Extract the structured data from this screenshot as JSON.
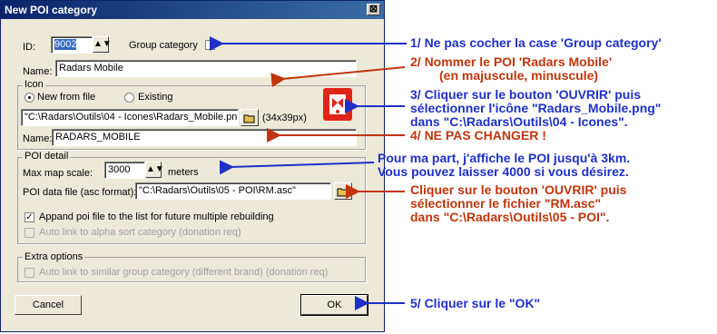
{
  "dialog": {
    "title": "New POI category",
    "close_glyph": "⊠",
    "id_label": "ID:",
    "id_value": "9002",
    "group_category_label": "Group category",
    "group_category_checked": false,
    "name_label": "Name:",
    "name_value": "Radars Mobile",
    "icon": {
      "group_title": "Icon",
      "new_from_file_label": "New from file",
      "existing_label": "Existing",
      "file_path": "\"C:\\Radars\\Outils\\04 - Icones\\Radars_Mobile.pn",
      "size_text": "(34x39px)",
      "name_label": "Name:",
      "name_value": "RADARS_MOBILE"
    },
    "poi_detail": {
      "group_title": "POI detail",
      "max_scale_label": "Max map scale:",
      "max_scale_value": "3000",
      "meters_label": "meters",
      "data_file_label": "POI data file (asc format):",
      "data_file_value": "\"C:\\Radars\\Outils\\05 - POI\\RM.asc\"",
      "append_label": "Appand poi file to the list for future multiple rebuilding",
      "append_checked": true,
      "auto_alpha_label": "Auto link to alpha sort category (donation req)"
    },
    "extra": {
      "group_title": "Extra options",
      "auto_group_label": "Auto link to similar group category (different brand) (donation req)"
    },
    "cancel_label": "Cancel",
    "ok_label": "OK"
  },
  "annotations": [
    {
      "lines": [
        "1/ Ne pas cocher la case 'Group category'"
      ],
      "color": "#1f30c8"
    },
    {
      "lines": [
        "2/ Nommer le POI 'Radars Mobile'",
        "(en majuscule, minuscule)"
      ],
      "color": "#c0350b"
    },
    {
      "lines": [
        "3/ Cliquer sur le bouton 'OUVRIR' puis",
        "sélectionner l'icône \"Radars_Mobile.png\"",
        "dans \"C:\\Radars\\Outils\\04 - Icones\"."
      ],
      "color": "#1f30c8"
    },
    {
      "lines": [
        "4/ NE PAS CHANGER !"
      ],
      "color": "#c0350b"
    },
    {
      "lines": [
        "Pour ma part, j'affiche le POI jusqu'à 3km.",
        "Vous pouvez laisser 4000 si vous désirez."
      ],
      "color": "#1f30c8"
    },
    {
      "lines": [
        "Cliquer sur le bouton 'OUVRIR' puis",
        "sélectionner le fichier \"RM.asc\"",
        "dans \"C:\\Radars\\Outils\\05 - POI\"."
      ],
      "color": "#c0350b"
    },
    {
      "lines": [
        "5/ Cliquer sur le \"OK\""
      ],
      "color": "#1f30c8"
    }
  ],
  "icons": [
    "close-icon",
    "spin-icon",
    "folder-open-icon",
    "radar-poi-icon"
  ]
}
